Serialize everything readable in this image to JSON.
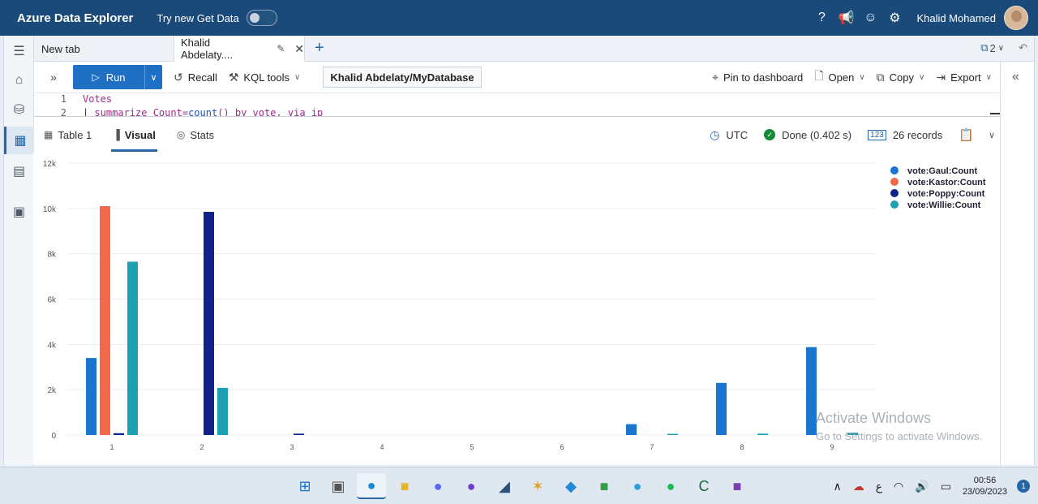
{
  "header": {
    "title": "Azure Data Explorer",
    "try_new": "Try new Get Data",
    "user_name": "Khalid Mohamed"
  },
  "tabs": {
    "new_tab": "New tab",
    "active_tab": "Khalid Abdelaty....",
    "copies_count": "2"
  },
  "toolbar": {
    "run": "Run",
    "recall": "Recall",
    "kql_tools": "KQL tools",
    "database": "Khalid Abdelaty/MyDatabase",
    "pin": "Pin to dashboard",
    "open": "Open",
    "copy": "Copy",
    "export": "Export"
  },
  "editor": {
    "line1_num": "1",
    "line2_num": "2",
    "line1": "Votes",
    "line2_pipe": "| ",
    "line2_kw": "summarize",
    "line2_a": " Count=",
    "line2_fn": "count",
    "line2_b": "() by vote, via ip"
  },
  "results": {
    "tabs": [
      "Table 1",
      "Visual",
      "Stats"
    ],
    "timezone": "UTC",
    "status": "Done (0.402 s)",
    "records": "26 records"
  },
  "chart_data": {
    "type": "bar",
    "categories": [
      "1",
      "2",
      "3",
      "4",
      "5",
      "6",
      "7",
      "8",
      "9"
    ],
    "ylim": [
      0,
      12000
    ],
    "yticks": [
      "0",
      "2k",
      "4k",
      "6k",
      "8k",
      "10k",
      "12k"
    ],
    "ytick_values": [
      0,
      2000,
      4000,
      6000,
      8000,
      10000,
      12000
    ],
    "grid": true,
    "legend_position": "top-right",
    "series": [
      {
        "name": "vote:Gaul:Count",
        "color": "#1a75cf",
        "values": [
          3400,
          0,
          0,
          0,
          0,
          0,
          480,
          2300,
          3880
        ]
      },
      {
        "name": "vote:Kastor:Count",
        "color": "#f2694c",
        "values": [
          10100,
          0,
          0,
          0,
          0,
          0,
          0,
          0,
          0
        ]
      },
      {
        "name": "vote:Poppy:Count",
        "color": "#10218b",
        "values": [
          80,
          9850,
          60,
          0,
          0,
          0,
          0,
          0,
          0
        ]
      },
      {
        "name": "vote:Willie:Count",
        "color": "#1ba1b1",
        "values": [
          7650,
          2080,
          0,
          0,
          0,
          0,
          30,
          60,
          100
        ]
      }
    ]
  },
  "watermark": {
    "title": "Activate Windows",
    "subtitle": "Go to Settings to activate Windows."
  },
  "taskbar": {
    "time": "00:56",
    "date": "23/09/2023",
    "notifications": "1",
    "lang": "ع"
  }
}
